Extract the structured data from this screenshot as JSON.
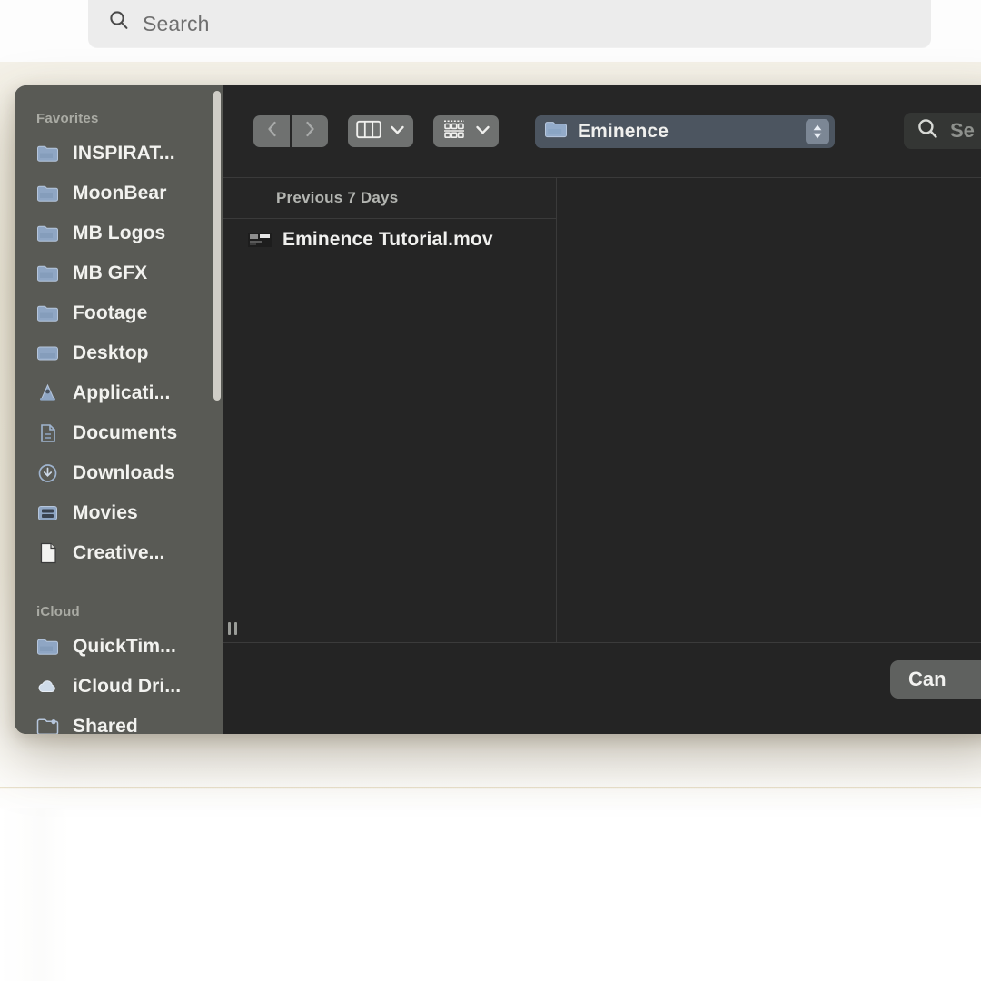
{
  "app_search": {
    "placeholder": "Search",
    "icon": "search-icon"
  },
  "dialog": {
    "sidebar": {
      "sections": [
        {
          "header": "Favorites",
          "items": [
            {
              "label": "INSPIRAT...",
              "icon": "folder-icon"
            },
            {
              "label": "MoonBear",
              "icon": "folder-icon"
            },
            {
              "label": "MB Logos",
              "icon": "folder-icon"
            },
            {
              "label": "MB GFX",
              "icon": "folder-icon"
            },
            {
              "label": "Footage",
              "icon": "folder-icon"
            },
            {
              "label": "Desktop",
              "icon": "desktop-folder-icon"
            },
            {
              "label": "Applicati...",
              "icon": "applications-icon"
            },
            {
              "label": "Documents",
              "icon": "documents-icon"
            },
            {
              "label": "Downloads",
              "icon": "downloads-icon"
            },
            {
              "label": "Movies",
              "icon": "movies-icon"
            },
            {
              "label": "Creative...",
              "icon": "document-file-icon"
            }
          ]
        },
        {
          "header": "iCloud",
          "items": [
            {
              "label": "QuickTim...",
              "icon": "folder-icon"
            },
            {
              "label": "iCloud Dri...",
              "icon": "icloud-icon"
            },
            {
              "label": "Shared",
              "icon": "shared-folder-icon"
            }
          ]
        }
      ]
    },
    "toolbar": {
      "back_icon": "chevron-left-icon",
      "forward_icon": "chevron-right-icon",
      "view_icon": "column-view-icon",
      "view_chevron": "chevron-down-icon",
      "group_icon": "group-by-icon",
      "group_chevron": "chevron-down-icon",
      "path": {
        "label": "Eminence",
        "icon": "folder-icon",
        "stepper_icon": "up-down-stepper-icon"
      },
      "search": {
        "placeholder": "Se",
        "icon": "search-icon"
      }
    },
    "file_list": {
      "group_header": "Previous 7 Days",
      "rows": [
        {
          "name": "Eminence Tutorial.mov",
          "icon": "movie-file-icon"
        }
      ]
    },
    "splitter": {
      "icon": "resize-handle-icon"
    },
    "buttons": {
      "cancel": "Can"
    }
  },
  "colors": {
    "sidebar_bg": "#595a55",
    "dialog_bg": "#252525",
    "toolbar_bg": "#262626",
    "path_popup_bg": "#4c5560",
    "accent_folder": "#8fa6c4",
    "page_cream": "#efebdd",
    "topbar_bg": "#ececec"
  }
}
